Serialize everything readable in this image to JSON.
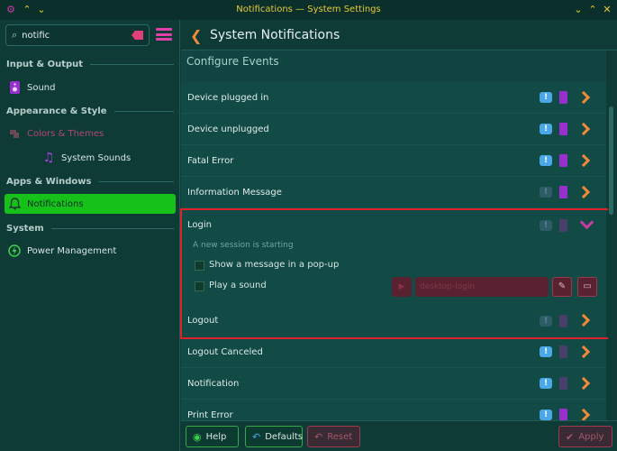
{
  "window": {
    "title": "Notifications — System Settings"
  },
  "sidebar": {
    "search_value": "notific",
    "categories": [
      {
        "label": "Input & Output"
      },
      {
        "label": "Appearance & Style"
      },
      {
        "label": "Apps & Windows"
      },
      {
        "label": "System"
      }
    ],
    "items": [
      {
        "label": "Sound",
        "icon": "speaker-icon"
      },
      {
        "label": "Colors & Themes",
        "icon": "palette-icon"
      },
      {
        "label": "System Sounds",
        "icon": "music-note-icon"
      },
      {
        "label": "Notifications",
        "icon": "bell-icon",
        "active": true
      },
      {
        "label": "Power Management",
        "icon": "power-icon"
      }
    ]
  },
  "header": {
    "title": "System Notifications"
  },
  "events": {
    "heading": "Configure Events",
    "rows": [
      {
        "name": "Device plugged in",
        "popup": true,
        "sound": true
      },
      {
        "name": "Device unplugged",
        "popup": true,
        "sound": true
      },
      {
        "name": "Fatal Error",
        "popup": true,
        "sound": true
      },
      {
        "name": "Information Message",
        "popup": false,
        "sound": true
      },
      {
        "name": "Logout",
        "popup": false,
        "sound": false
      },
      {
        "name": "Logout Canceled",
        "popup": true,
        "sound": false
      },
      {
        "name": "Notification",
        "popup": true,
        "sound": false
      },
      {
        "name": "Print Error",
        "popup": true,
        "sound": true
      }
    ],
    "expanded": {
      "name": "Login",
      "description": "A new session is starting",
      "option_popup": "Show a message in a pop-up",
      "option_sound": "Play a sound",
      "sound_file": "desktop-login"
    }
  },
  "footer": {
    "help": "Help",
    "defaults": "Defaults",
    "reset": "Reset",
    "apply": "Apply"
  },
  "colors": {
    "accent_green": "#16c21a",
    "accent_orange": "#f08a3a",
    "accent_magenta": "#c93aa3",
    "highlight_red": "#e0202a",
    "background": "#0f3a36"
  }
}
